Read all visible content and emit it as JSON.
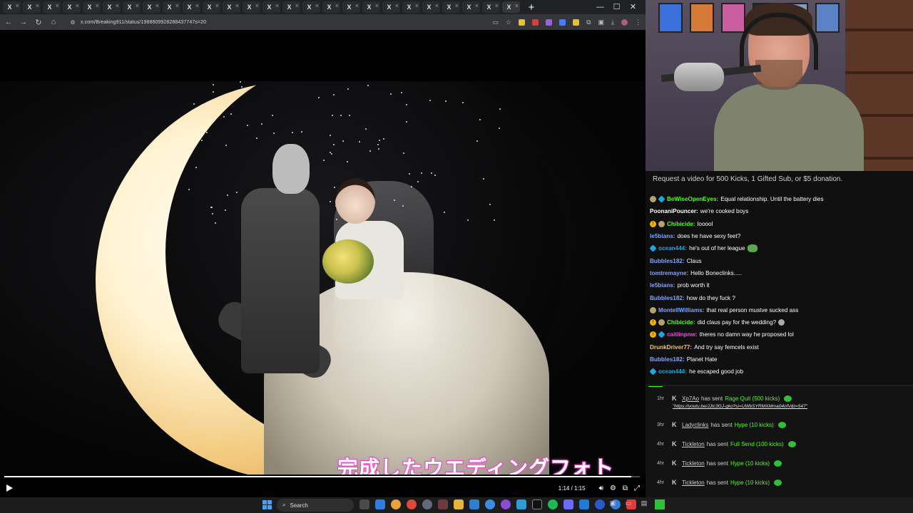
{
  "browser": {
    "tabs": [
      {
        "label": "X"
      },
      {
        "label": "X"
      },
      {
        "label": "X"
      },
      {
        "label": "X"
      },
      {
        "label": "X"
      },
      {
        "label": "X"
      },
      {
        "label": "X"
      },
      {
        "label": "X"
      },
      {
        "label": "X"
      },
      {
        "label": "X"
      },
      {
        "label": "X"
      },
      {
        "label": "X"
      },
      {
        "label": "X"
      },
      {
        "label": "X"
      },
      {
        "label": "X"
      },
      {
        "label": "X"
      },
      {
        "label": "X"
      },
      {
        "label": "X"
      },
      {
        "label": "X"
      },
      {
        "label": "X"
      },
      {
        "label": "X"
      },
      {
        "label": "X"
      },
      {
        "label": "X"
      },
      {
        "label": "X"
      },
      {
        "label": "X"
      },
      {
        "label": "X"
      }
    ],
    "url": "x.com/Breaking911/status/1988609928288437747s=20"
  },
  "video": {
    "subtitle": "完成したウエディングフォト",
    "time_display": "1:14 / 1:15",
    "progress_fraction": 0.986
  },
  "taskbar": {
    "search_placeholder": "Search"
  },
  "chat": {
    "banner": "Request a video for 500 Kicks, 1 Gifted Sub, or $5 donation.",
    "messages": [
      {
        "badges": [
          "moneybag",
          "blue"
        ],
        "user": "BeWiseOpenEyes:",
        "user_color": "#53fc18",
        "text": "Equal relationship. Until the battery dies"
      },
      {
        "badges": [],
        "user": "PoonaniPouncer:",
        "user_color": "#ffffff",
        "text": "we're cooked boys"
      },
      {
        "badges": [
          "gold",
          "moneybag"
        ],
        "user": "Chibicide:",
        "user_color": "#53fc18",
        "text": "looool"
      },
      {
        "badges": [],
        "user": "le5bians:",
        "user_color": "#7fa6ff",
        "text": "does he have sexy feet?"
      },
      {
        "badges": [
          "blue"
        ],
        "user": "ocean444:",
        "user_color": "#1fa6e0",
        "text": "he's out of her league",
        "emote": true
      },
      {
        "badges": [],
        "user": "Bubbles182:",
        "user_color": "#7fa6ff",
        "text": "Claus"
      },
      {
        "badges": [],
        "user": "tomtremayne:",
        "user_color": "#7fa6ff",
        "text": "Hello Boneclinks....."
      },
      {
        "badges": [],
        "user": "le5bians:",
        "user_color": "#7fa6ff",
        "text": "prob worth it"
      },
      {
        "badges": [],
        "user": "Bubbles182:",
        "user_color": "#7fa6ff",
        "text": "how do they fuck ?"
      },
      {
        "badges": [
          "moneybag"
        ],
        "user": "MontellWilliams:",
        "user_color": "#7fa6ff",
        "text": "that real person mustve sucked ass"
      },
      {
        "badges": [
          "gold",
          "moneybag"
        ],
        "user": "Chibicide:",
        "user_color": "#53fc18",
        "text": "did claus pay for the wedding?",
        "emote2": true
      },
      {
        "badges": [
          "gold",
          "blue"
        ],
        "user": "caitlinpnw:",
        "user_color": "#e64cd9",
        "text": "theres no damn way he proposed lol"
      },
      {
        "badges": [],
        "user": "DrunkDriver77:",
        "user_color": "#f7c46c",
        "text": "And try say femcels exist"
      },
      {
        "badges": [],
        "user": "Bubbles182:",
        "user_color": "#7fa6ff",
        "text": "Planet Hate"
      },
      {
        "badges": [
          "blue"
        ],
        "user": "ocean444:",
        "user_color": "#1fa6e0",
        "text": "he escaped good job"
      }
    ],
    "events": [
      {
        "time": "1hr",
        "user": "Xp7Ao",
        "verb": "has sent",
        "item": "Rage Quit (500 kicks)",
        "link": "https://youtu.be/JJtc3GJ-gko?si=UWbSYRMXMma04ofV&t=547"
      },
      {
        "time": "3hr",
        "user": "Ladyclinks",
        "verb": "has sent",
        "item": "Hype (10 kicks)"
      },
      {
        "time": "4hr",
        "user": "Tickleton",
        "verb": "has sent",
        "item": "Full Send (100 kicks)"
      },
      {
        "time": "4hr",
        "user": "Tickleton",
        "verb": "has sent",
        "item": "Hype (10 kicks)"
      },
      {
        "time": "4hr",
        "user": "Tickleton",
        "verb": "has sent",
        "item": "Hype (10 kicks)"
      },
      {
        "time": "4hr",
        "user": "Tickleton",
        "verb": "has sent",
        "item": "Hype (10 kicks)"
      }
    ]
  },
  "colors": {
    "kick_green": "#53fc18",
    "subtitle_pink": "#d23ab7",
    "browser_dark": "#202124"
  }
}
